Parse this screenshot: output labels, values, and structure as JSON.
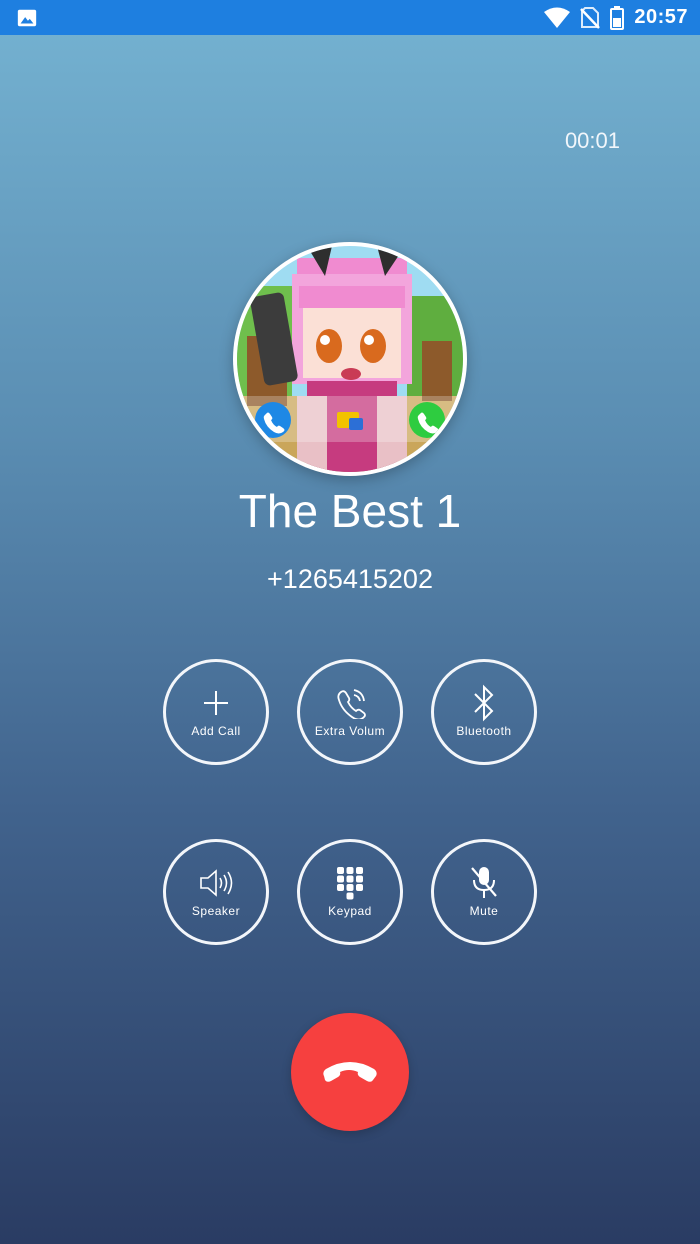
{
  "status_bar": {
    "time": "20:57",
    "left_icon": "image-icon",
    "right_icons": [
      "wifi-icon",
      "no-sim-icon",
      "battery-icon"
    ]
  },
  "call": {
    "timer": "00:01",
    "caller_name": "The Best 1",
    "caller_number": "+1265415202"
  },
  "controls": [
    {
      "label": "Add Call",
      "icon": "plus-icon"
    },
    {
      "label": "Extra Volum",
      "icon": "phone-volume-icon"
    },
    {
      "label": "Bluetooth",
      "icon": "bluetooth-icon"
    },
    {
      "label": "Speaker",
      "icon": "speaker-icon"
    },
    {
      "label": "Keypad",
      "icon": "keypad-icon"
    },
    {
      "label": "Mute",
      "icon": "mic-off-icon"
    }
  ],
  "hangup": {
    "icon": "end-call-icon"
  },
  "colors": {
    "status_bar": "#1e7fe0",
    "hangup": "#f6403f",
    "bg_top": "#75b3d2",
    "bg_bottom": "#2a3c63"
  }
}
